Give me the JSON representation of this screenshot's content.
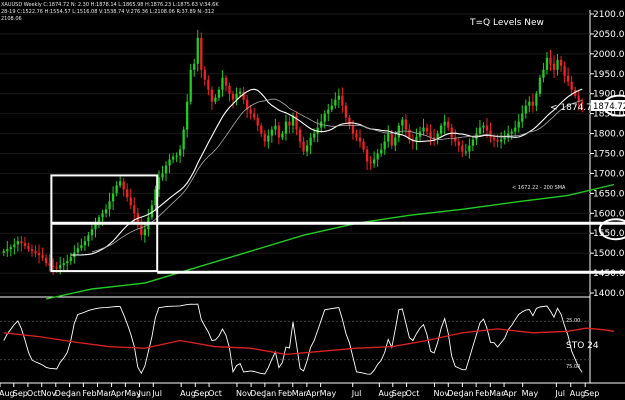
{
  "header": {
    "line1": "XAUUSD  Weekly  C:1874.72  N:  2.30  H:1878.14  L:1865.98  H:1876.23  L:1875.63  V:34.6K",
    "line2": "28-19  C:1522.76  H:1554.57  L:1516.08  V:1538.74  V:276.36  L:2108.06  R:37.89  N:-312",
    "line3": "2108.06"
  },
  "title": "T=Q Levels New",
  "price_label": "< 1874.72",
  "price_box": "1874.72",
  "sma_label": "< 1672.22 - 200 SMA",
  "oscillator": {
    "name_label": "STO  24",
    "upper_label": "25.00",
    "lower_label": "75.00"
  },
  "colors": {
    "up": "#22cc22",
    "down": "#ee2222",
    "sma200": "#22cc22",
    "ma_white": "#ffffff",
    "ma_gray": "#aaaaaa",
    "sto_main": "#ffffff",
    "sto_signal": "#dd2222",
    "background": "#000000"
  },
  "chart_data": {
    "type": "candlestick",
    "y_axis": {
      "ticks": [
        2100,
        2050,
        2000,
        1950,
        1900,
        1850,
        1800,
        1750,
        1700,
        1650,
        1600,
        1550,
        1500,
        1450,
        1400
      ],
      "tick_labels": [
        "2100.00",
        "2050.00",
        "2000.00",
        "1950.00",
        "1900.00",
        "1850.00",
        "1800.00",
        "1750.00",
        "1700.00",
        "1650.00",
        "1600.00",
        "1550.00",
        "1500.00",
        "1450.00",
        "1400.00"
      ],
      "ylim": [
        1390,
        2110
      ]
    },
    "x_axis": {
      "labels": [
        "Aug",
        "Sep",
        "Oct",
        "Nov",
        "Dec",
        "Jan",
        "Feb",
        "Mar",
        "Apr",
        "May",
        "Jun",
        "Jul",
        "Aug",
        "Sep",
        "Oct",
        "Nov",
        "Dec",
        "Jan",
        "Feb",
        "Mar",
        "Apr",
        "May",
        "Jul",
        "Aug",
        "Sep",
        "Oct",
        "Nov",
        "Dec",
        "Jan",
        "Feb",
        "Mar",
        "Apr",
        "May",
        "Jul",
        "Aug",
        "Sep"
      ],
      "label_weeks": [
        0,
        4.3,
        8.7,
        13,
        17.4,
        21.7,
        26,
        30.4,
        34.8,
        39.1,
        43.5,
        47.8,
        56.5,
        60.9,
        65.2,
        73.9,
        78.3,
        82.6,
        87,
        91.3,
        95.7,
        100,
        110,
        118.3,
        122.5,
        126.8,
        135.5,
        139.8,
        144.2,
        148.5,
        152.9,
        157.2,
        163,
        173.5,
        178,
        182.5
      ],
      "week_range": [
        0,
        184
      ]
    },
    "close_series": [
      1505,
      1510,
      1515,
      1522,
      1530,
      1525,
      1518,
      1510,
      1505,
      1500,
      1495,
      1488,
      1475,
      1468,
      1465,
      1462,
      1470,
      1475,
      1480,
      1490,
      1502,
      1512,
      1520,
      1530,
      1545,
      1560,
      1575,
      1590,
      1600,
      1610,
      1630,
      1650,
      1670,
      1680,
      1660,
      1640,
      1620,
      1600,
      1570,
      1545,
      1560,
      1590,
      1620,
      1660,
      1690,
      1700,
      1720,
      1735,
      1742,
      1745,
      1760,
      1810,
      1880,
      1960,
      1975,
      2040,
      1960,
      1935,
      1910,
      1880,
      1890,
      1910,
      1940,
      1920,
      1900,
      1885,
      1900,
      1905,
      1885,
      1860,
      1850,
      1840,
      1820,
      1800,
      1780,
      1795,
      1810,
      1820,
      1790,
      1800,
      1830,
      1820,
      1845,
      1810,
      1780,
      1755,
      1770,
      1790,
      1800,
      1815,
      1830,
      1850,
      1860,
      1870,
      1885,
      1895,
      1870,
      1840,
      1820,
      1800,
      1790,
      1780,
      1760,
      1730,
      1725,
      1735,
      1750,
      1760,
      1780,
      1800,
      1770,
      1790,
      1820,
      1835,
      1810,
      1785,
      1780,
      1792,
      1805,
      1815,
      1805,
      1790,
      1788,
      1800,
      1820,
      1830,
      1815,
      1790,
      1780,
      1770,
      1755,
      1755,
      1770,
      1785,
      1800,
      1815,
      1820,
      1808,
      1790,
      1785,
      1780,
      1785,
      1790,
      1800,
      1805,
      1815,
      1830,
      1850,
      1870,
      1880,
      1870,
      1900,
      1940,
      1960,
      1990,
      1975,
      1960,
      1985,
      1970,
      1945,
      1930,
      1910,
      1895,
      1880,
      1874.72
    ],
    "sma200": {
      "name": "200 SMA",
      "last_value": 1672.22,
      "points": [
        [
          12,
          1385
        ],
        [
          25,
          1410
        ],
        [
          40,
          1425
        ],
        [
          55,
          1465
        ],
        [
          70,
          1505
        ],
        [
          85,
          1545
        ],
        [
          100,
          1575
        ],
        [
          115,
          1595
        ],
        [
          130,
          1610
        ],
        [
          145,
          1628
        ],
        [
          160,
          1645
        ],
        [
          173,
          1672.22
        ]
      ]
    },
    "oscillator": {
      "name": "STO",
      "last_value": 24,
      "range": [
        0,
        100
      ],
      "levels": [
        25,
        75
      ],
      "level_labels": [
        "25.00",
        "75.00"
      ],
      "signal_points": [
        [
          0,
          40
        ],
        [
          10,
          45
        ],
        [
          20,
          52
        ],
        [
          30,
          58
        ],
        [
          40,
          60
        ],
        [
          50,
          50
        ],
        [
          60,
          58
        ],
        [
          70,
          60
        ],
        [
          80,
          68
        ],
        [
          90,
          64
        ],
        [
          100,
          60
        ],
        [
          110,
          58
        ],
        [
          120,
          50
        ],
        [
          130,
          40
        ],
        [
          140,
          35
        ],
        [
          150,
          40
        ],
        [
          160,
          38
        ],
        [
          165,
          34
        ],
        [
          170,
          36
        ],
        [
          173,
          38
        ]
      ]
    },
    "levels": [
      {
        "name": "upper-level",
        "value": 1575,
        "week_start": 14,
        "week_end": 184
      },
      {
        "name": "lower-level",
        "value": 1452,
        "week_start": 44,
        "week_end": 184
      }
    ],
    "annotations": [
      {
        "type": "rectangle",
        "week_start": 14,
        "week_end": 44,
        "price_top": 1695,
        "price_bottom": 1455
      },
      {
        "type": "ellipse",
        "week": 175,
        "price": 1870
      },
      {
        "type": "ellipse",
        "week": 174,
        "price": 1560
      }
    ]
  }
}
